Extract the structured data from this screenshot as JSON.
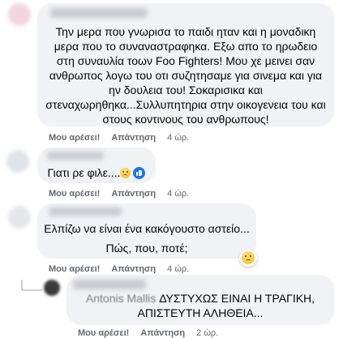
{
  "comments": [
    {
      "lines": [
        "Την μερα που γνωρισα το παιδι ηταν και η μοναδικη",
        "μερα που το συναναστραφηκα. Εξω απο το ηρωδειο",
        "στη συναυλία τοων Foo Fighters! Μου χε μεινει σαν",
        "ανθρωπος λογω του οτι συζητησαμε για σινεμα και για",
        "ην δουλεια του! Σοκαρισικα και",
        "στεναχωρηθηκα...Συλλυπητηρια στην οικογενεια του και",
        "στους κοντινους του ανθρωπους!"
      ],
      "like_label": "Μου αρέσει!",
      "reply_label": "Απάντηση",
      "time": "4 ώρ."
    },
    {
      "lines": [
        "Γιατι ρε φιλε...."
      ],
      "emoji_icon": "sad-face-emoji-icon",
      "reaction_icon": "like-reaction-icon",
      "like_label": "Μου αρέσει!",
      "reply_label": "Απάντηση",
      "time": "4 ώρ."
    },
    {
      "lines": [
        "Ελπίζω να είναι ένα κακόγουστο αστείο...",
        "Πώς, που, ποτέ;"
      ],
      "reaction_icon": "sad-reaction-icon",
      "like_label": "Μου αρέσει!",
      "reply_label": "Απάντηση",
      "time": "4 ώρ."
    },
    {
      "author_partial": "Antonis Mallis",
      "text_line1": "ΔΥΣΤΥΧΩΣ ΕΙΝΑΙ Η ΤΡΑΓΙΚΗ,",
      "text_line2": "ΑΠΙΣΤΕΥΤΗ ΑΛΗΘΕΙΑ...",
      "like_label": "Μου αρέσει!",
      "reply_label": "Απάντηση",
      "time": "2 ώρ."
    }
  ],
  "colors": {
    "bubble": "#f0f2f5",
    "meta_text": "#65676b",
    "like_blue": "#1877f2",
    "emoji_yellow": "#f7b928"
  }
}
